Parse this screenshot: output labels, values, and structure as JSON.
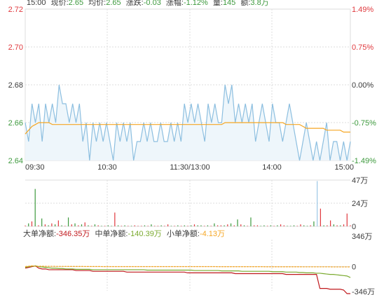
{
  "header": {
    "time": "15:00",
    "price_label": "现价:",
    "price": "2.65",
    "avg_label": "均价:",
    "avg": "2.65",
    "change_label": "涨跌:",
    "change": "-0.03",
    "pct_label": "涨幅:",
    "pct": "-1.12%",
    "vol_label": "量:",
    "vol": "145",
    "amount_label": "额:",
    "amount": "3.8万"
  },
  "flow": {
    "large_label": "大单净额:",
    "large": "-346.35万",
    "mid_label": "中单净额:",
    "mid": "-140.39万",
    "small_label": "小单净额:",
    "small": "-4.13万"
  },
  "colors": {
    "up": "#e0393e",
    "down": "#3e9a3e",
    "neutral": "#3a3a3a",
    "price_line": "#8dbfe0",
    "price_fill": "#eef6fb",
    "avg_line": "#f5a623",
    "grid": "#dddddd",
    "large": "#c0181c",
    "mid": "#7aaa2e",
    "small": "#f5a623"
  },
  "chart_data": [
    {
      "type": "line",
      "x_ticks": [
        "09:30",
        "10:30",
        "11:30/13:00",
        "14:00",
        "15:00"
      ],
      "y_ticks_left": [
        "2.72",
        "2.70",
        "2.68",
        "2.66",
        "2.64"
      ],
      "y_ticks_right": [
        "1.49%",
        "0.75%",
        "0.00%",
        "-0.75%",
        "-1.49%"
      ],
      "ylim": [
        2.64,
        2.72
      ],
      "series": [
        {
          "values": [
            2.66,
            2.65,
            2.67,
            2.66,
            2.67,
            2.65,
            2.67,
            2.66,
            2.67,
            2.66,
            2.68,
            2.67,
            2.67,
            2.66,
            2.67,
            2.66,
            2.67,
            2.65,
            2.66,
            2.64,
            2.66,
            2.65,
            2.66,
            2.65,
            2.66,
            2.65,
            2.64,
            2.66,
            2.65,
            2.66,
            2.65,
            2.66,
            2.64,
            2.65,
            2.65,
            2.66,
            2.65,
            2.66,
            2.65,
            2.65,
            2.66,
            2.65,
            2.65,
            2.66,
            2.65,
            2.66,
            2.65,
            2.67,
            2.66,
            2.67,
            2.66,
            2.67,
            2.66,
            2.65,
            2.67,
            2.66,
            2.67,
            2.66,
            2.66,
            2.68,
            2.67,
            2.68,
            2.66,
            2.67,
            2.66,
            2.67,
            2.66,
            2.67,
            2.65,
            2.66,
            2.67,
            2.66,
            2.65,
            2.67,
            2.66,
            2.66,
            2.65,
            2.66,
            2.67,
            2.66,
            2.65,
            2.64,
            2.65,
            2.66,
            2.65,
            2.64,
            2.65,
            2.64,
            2.65,
            2.66,
            2.64,
            2.65,
            2.65,
            2.64,
            2.65,
            2.64,
            2.65
          ]
        },
        {
          "values": [
            2.654,
            2.656,
            2.658,
            2.659,
            2.66,
            2.66,
            2.66,
            2.66,
            2.659,
            2.659,
            2.659,
            2.659,
            2.659,
            2.659,
            2.659,
            2.659,
            2.659,
            2.659,
            2.659,
            2.659,
            2.659,
            2.659,
            2.659,
            2.659,
            2.659,
            2.659,
            2.659,
            2.659,
            2.659,
            2.659,
            2.659,
            2.659,
            2.659,
            2.659,
            2.659,
            2.659,
            2.659,
            2.659,
            2.659,
            2.659,
            2.659,
            2.659,
            2.659,
            2.659,
            2.659,
            2.659,
            2.659,
            2.659,
            2.659,
            2.659,
            2.659,
            2.659,
            2.659,
            2.659,
            2.659,
            2.659,
            2.659,
            2.659,
            2.659,
            2.66,
            2.66,
            2.66,
            2.66,
            2.66,
            2.66,
            2.66,
            2.66,
            2.66,
            2.66,
            2.66,
            2.66,
            2.66,
            2.66,
            2.66,
            2.66,
            2.66,
            2.66,
            2.659,
            2.659,
            2.659,
            2.659,
            2.659,
            2.658,
            2.657,
            2.657,
            2.657,
            2.657,
            2.657,
            2.657,
            2.656,
            2.656,
            2.656,
            2.656,
            2.656,
            2.655,
            2.655,
            2.655
          ]
        }
      ]
    },
    {
      "type": "bar",
      "y_ticks_right": [
        "47万",
        "24万",
        "0"
      ],
      "ylim": [
        0,
        47
      ],
      "values": [
        0.8,
        3,
        5,
        38,
        1,
        8,
        2,
        1,
        3,
        2,
        6,
        1,
        0.5,
        9,
        2,
        3,
        1,
        2,
        4,
        1,
        0.5,
        2,
        1,
        0.5,
        0.5,
        1,
        0.5,
        14,
        1,
        0.5,
        1,
        0.5,
        0.5,
        1,
        0.5,
        0.5,
        1,
        0.5,
        2,
        0.5,
        0.5,
        1,
        0.5,
        2,
        0.5,
        0.5,
        1,
        0.5,
        1,
        0.5,
        1,
        2,
        1,
        1,
        0.5,
        1,
        0.5,
        3,
        1,
        1,
        1,
        2,
        3,
        1,
        7,
        2,
        1,
        0.5,
        9,
        1,
        1,
        0.5,
        1,
        0.5,
        1,
        0.5,
        1,
        2,
        1,
        0.5,
        0.5,
        1,
        0.5,
        2,
        1,
        0.5,
        1,
        5,
        46,
        18,
        1,
        1,
        6,
        2,
        1,
        1,
        2,
        13,
        1
      ]
    },
    {
      "type": "line",
      "y_ticks_right": [
        "346万",
        "0",
        "-346万"
      ],
      "ylim": [
        -346,
        346
      ],
      "series": [
        {
          "values": [
            -20,
            -10,
            0,
            10,
            -20,
            -30,
            -30,
            -40,
            -40,
            -40,
            -40,
            -40,
            -40,
            -40,
            -40,
            -50,
            -50,
            -50,
            -50,
            -50,
            -60,
            -60,
            -60,
            -60,
            -60,
            -60,
            -60,
            -60,
            -60,
            -60,
            -70,
            -70,
            -70,
            -70,
            -70,
            -70,
            -70,
            -70,
            -70,
            -70,
            -70,
            -70,
            -70,
            -70,
            -70,
            -70,
            -70,
            -70,
            -80,
            -80,
            -80,
            -80,
            -80,
            -80,
            -80,
            -80,
            -80,
            -80,
            -80,
            -80,
            -80,
            -80,
            -90,
            -90,
            -90,
            -90,
            -90,
            -90,
            -90,
            -90,
            -90,
            -90,
            -90,
            -90,
            -90,
            -90,
            -90,
            -100,
            -100,
            -100,
            -100,
            -100,
            -100,
            -100,
            -100,
            -100,
            -100,
            -280,
            -280,
            -280,
            -290,
            -290,
            -290,
            -290,
            -300,
            -346,
            -346
          ]
        },
        {
          "values": [
            -10,
            0,
            5,
            10,
            0,
            -5,
            -10,
            -15,
            -20,
            -20,
            -25,
            -25,
            -30,
            -30,
            -30,
            -35,
            -35,
            -35,
            -35,
            -35,
            -40,
            -40,
            -40,
            -40,
            -40,
            -40,
            -40,
            -40,
            -40,
            -40,
            -40,
            -40,
            -40,
            -40,
            -40,
            -40,
            -45,
            -45,
            -45,
            -45,
            -45,
            -45,
            -45,
            -45,
            -45,
            -45,
            -45,
            -45,
            -45,
            -45,
            -50,
            -50,
            -50,
            -50,
            -50,
            -50,
            -50,
            -50,
            -55,
            -55,
            -55,
            -55,
            -55,
            -55,
            -60,
            -60,
            -60,
            -60,
            -60,
            -60,
            -60,
            -60,
            -60,
            -65,
            -65,
            -65,
            -65,
            -70,
            -70,
            -70,
            -70,
            -75,
            -75,
            -80,
            -80,
            -80,
            -85,
            -85,
            -90,
            -95,
            -100,
            -100,
            -105,
            -110,
            -115,
            -120,
            -140
          ]
        },
        {
          "values": [
            0,
            5,
            10,
            5,
            5,
            5,
            4,
            4,
            4,
            3,
            3,
            3,
            3,
            2,
            2,
            2,
            2,
            2,
            1,
            1,
            1,
            1,
            1,
            0,
            0,
            0,
            0,
            0,
            0,
            0,
            0,
            0,
            0,
            0,
            0,
            0,
            0,
            0,
            0,
            0,
            0,
            0,
            0,
            0,
            0,
            0,
            0,
            0,
            0,
            0,
            0,
            0,
            0,
            0,
            0,
            0,
            0,
            -1,
            -1,
            -1,
            -1,
            -1,
            -1,
            -1,
            -1,
            -1,
            -1,
            -1,
            -1,
            -1,
            -1,
            -2,
            -2,
            -2,
            -2,
            -2,
            -2,
            -2,
            -2,
            -2,
            -2,
            -2,
            -3,
            -3,
            -3,
            -3,
            -3,
            -3,
            -3,
            -3,
            -3,
            -4,
            -4,
            -4,
            -4,
            -4,
            -4
          ]
        }
      ]
    }
  ]
}
